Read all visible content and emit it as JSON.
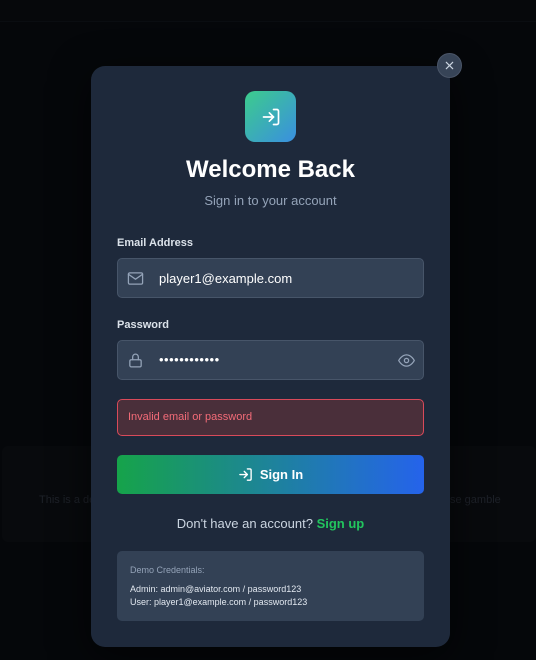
{
  "background": {
    "banner_left_text": "This is a de",
    "banner_right_text": "se gamble"
  },
  "modal": {
    "close_icon": "close-icon",
    "logo_icon": "sign-in-icon",
    "title": "Welcome Back",
    "subtitle": "Sign in to your account",
    "email": {
      "label": "Email Address",
      "value": "player1@example.com",
      "icon": "mail-icon"
    },
    "password": {
      "label": "Password",
      "masked_value": "••••••••••••",
      "icon": "lock-icon",
      "toggle_icon": "eye-icon"
    },
    "error_message": "Invalid email or password",
    "submit_label": "Sign In",
    "signup_prompt": "Don't have an account?",
    "signup_link": "Sign up",
    "demo": {
      "title": "Demo Credentials:",
      "admin_line": "Admin: admin@aviator.com / password123",
      "user_line": "User: player1@example.com / password123"
    }
  },
  "colors": {
    "modal_bg": "#1e293b",
    "field_bg": "#334155",
    "accent_green": "#22c55e",
    "accent_blue": "#2563eb",
    "error_text": "#f36b78"
  }
}
